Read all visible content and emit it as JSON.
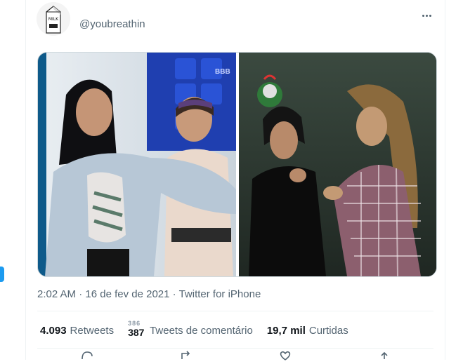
{
  "tweet": {
    "handle": "@youbreathin",
    "avatar_text": "MILK",
    "timestamp": "2:02 AM",
    "separator": "·",
    "date": "16 de fev de 2021",
    "source": "Twitter for iPhone"
  },
  "stats": {
    "retweets_count": "4.093",
    "retweets_label": "Retweets",
    "quote_count_old": "386",
    "quote_count": "387",
    "quote_label": "Tweets de comentário",
    "likes_count": "19,7 mil",
    "likes_label": "Curtidas"
  },
  "media": {
    "left_watermark": "BBB"
  },
  "colors": {
    "accent": "#1d9bf0",
    "secondary_text": "#536471",
    "border": "#cfd9de"
  }
}
